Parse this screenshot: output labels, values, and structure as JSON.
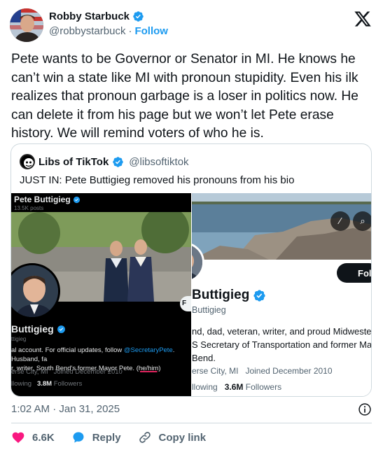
{
  "author": {
    "name": "Robby Starbuck",
    "handle": "@robbystarbuck",
    "separator": "·",
    "follow_label": "Follow"
  },
  "tweet_text": "Pete wants to be Governor or Senator in MI. He knows he can’t win a state like MI with pronoun stupidity. Even his ilk realizes that pronoun garbage is a loser in politics now. He can delete it from his page but we won’t let Pete erase history. We will remind voters of who he is.",
  "quote": {
    "name": "Libs of TikTok",
    "handle": "@libsoftiktok",
    "text": "JUST IN: Pete Buttigieg removed his pronouns from his bio",
    "left_image": {
      "top_name": "Pete Buttigieg",
      "top_posts": "13.5K posts",
      "follow_fragment": "F",
      "display_name": "Buttigieg",
      "handle": "ttigieg",
      "bio_1": "al account. For official updates, follow ",
      "bio_link": "@SecretaryPete",
      "bio_1b": ". Husband, fa",
      "bio_2": "r, writer, South Bend's former Mayor Pete. ",
      "bio_pronouns": "(he/him)",
      "location": "erse City, MI",
      "joined": "Joined December 2010",
      "following_label": "llowing",
      "followers_count": "3.8M",
      "followers_label": "Followers"
    },
    "right_image": {
      "follow_fragment": "Foll",
      "display_name": "Buttigieg",
      "handle": "Buttigieg",
      "bio_1": "nd, dad, veteran, writer, and proud Midweste",
      "bio_2": "S Secretary of Transportation and former Ma",
      "bio_3": "Bend.",
      "location": "erse City, MI",
      "joined": "Joined December 2010",
      "following_label": "llowing",
      "followers_count": "3.6M",
      "followers_label": "Followers"
    }
  },
  "timestamp": "1:02 AM · Jan 31, 2025",
  "actions": {
    "likes": "6.6K",
    "reply": "Reply",
    "copy_link": "Copy link"
  },
  "colors": {
    "accent": "#1d9bf0",
    "like": "#f91880",
    "text": "#0f1419",
    "muted": "#536471"
  },
  "icons": [
    "verified-badge-icon",
    "x-logo-icon",
    "info-icon",
    "heart-icon",
    "reply-icon",
    "link-icon"
  ]
}
